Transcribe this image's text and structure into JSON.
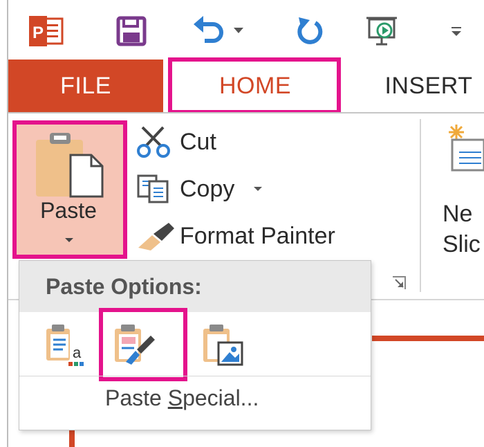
{
  "quick_access": {
    "items": [
      {
        "name": "powerpoint-logo-icon"
      },
      {
        "name": "save-icon"
      },
      {
        "name": "undo-icon"
      },
      {
        "name": "undo-dropdown-icon"
      },
      {
        "name": "redo-icon"
      },
      {
        "name": "slideshow-icon"
      },
      {
        "name": "customize-qat-icon"
      }
    ]
  },
  "tabs": [
    {
      "label": "FILE"
    },
    {
      "label": "HOME"
    },
    {
      "label": "INSERT"
    }
  ],
  "clipboard": {
    "paste_label": "Paste",
    "cut_label": "Cut",
    "copy_label": "Copy",
    "format_painter_label": "Format Painter"
  },
  "slides": {
    "new_slide_line1": "Ne",
    "new_slide_line2": "Slic"
  },
  "paste_menu": {
    "header": "Paste Options:",
    "options": [
      {
        "name": "use-destination-theme-icon"
      },
      {
        "name": "keep-source-formatting-icon"
      },
      {
        "name": "picture-icon"
      }
    ],
    "special_prefix": "Paste ",
    "special_underlined": "S",
    "special_suffix": "pecial..."
  },
  "colors": {
    "accent": "#d24726",
    "highlight": "#e4138c",
    "paste_bg": "#f6c5b6"
  }
}
